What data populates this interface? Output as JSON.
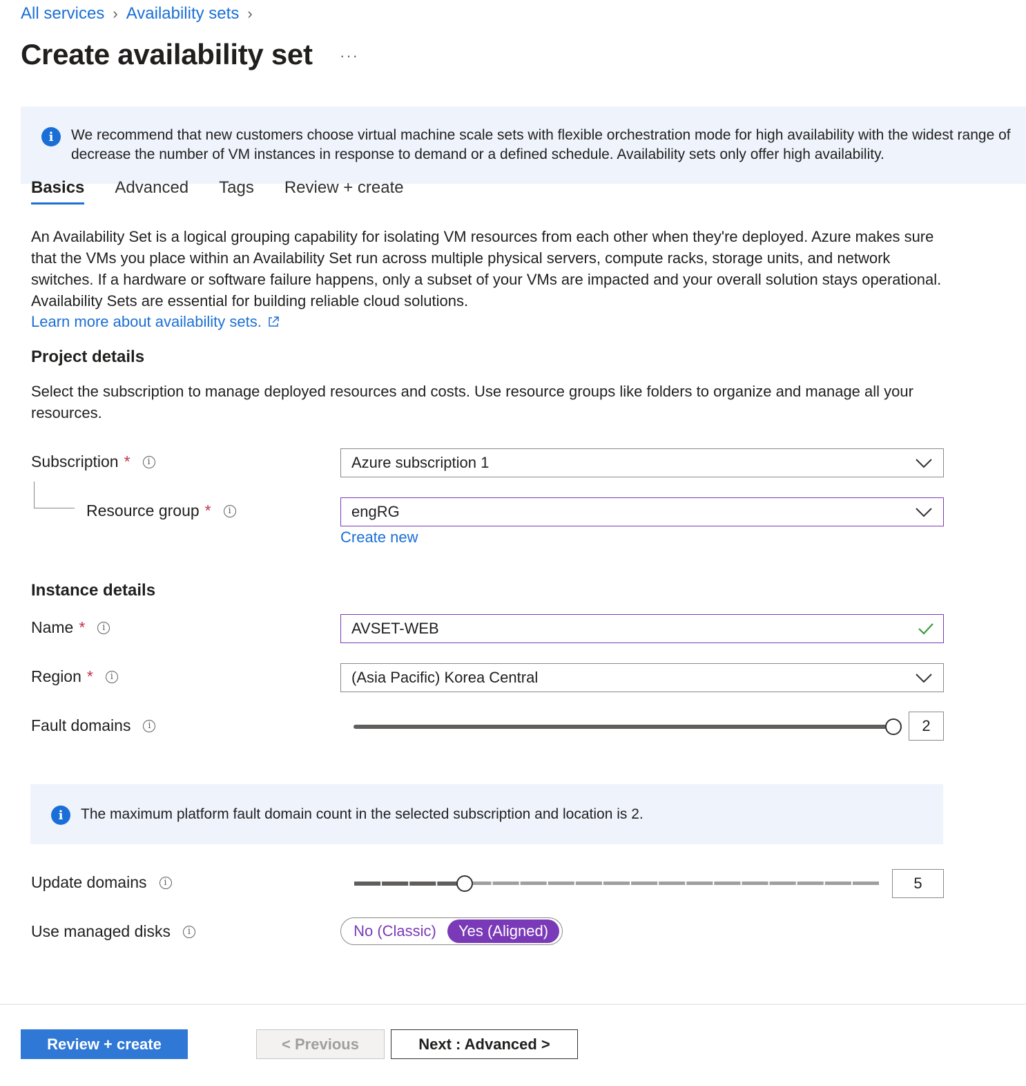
{
  "breadcrumb": {
    "items": [
      "All services",
      "Availability sets"
    ]
  },
  "page": {
    "title": "Create availability set",
    "more": "···"
  },
  "banner": {
    "line1": "We recommend that new customers choose virtual machine scale sets with flexible orchestration mode for high availability with the widest range of",
    "line2": "decrease the number of VM instances in response to demand or a defined schedule. Availability sets only offer high availability."
  },
  "tabs": [
    "Basics",
    "Advanced",
    "Tags",
    "Review + create"
  ],
  "description": "An Availability Set is a logical grouping capability for isolating VM resources from each other when they're deployed. Azure makes sure that the VMs you place within an Availability Set run across multiple physical servers, compute racks, storage units, and network switches. If a hardware or software failure happens, only a subset of your VMs are impacted and your overall solution stays operational. Availability Sets are essential for building reliable cloud solutions.",
  "learn_more": "Learn more about availability sets.",
  "project": {
    "heading": "Project details",
    "description": "Select the subscription to manage deployed resources and costs. Use resource groups like folders to organize and manage all your resources.",
    "subscription_label": "Subscription",
    "subscription_value": "Azure subscription 1",
    "resource_group_label": "Resource group",
    "resource_group_value": "engRG",
    "create_new": "Create new"
  },
  "instance": {
    "heading": "Instance details",
    "name_label": "Name",
    "name_value": "AVSET-WEB",
    "region_label": "Region",
    "region_value": "(Asia Pacific) Korea Central",
    "fault_label": "Fault domains",
    "fault_value": "2",
    "fault_fraction": 1.0,
    "fault_info": "The maximum platform fault domain count in the selected subscription and location is 2.",
    "update_label": "Update domains",
    "update_value": "5",
    "update_max": 20,
    "disks_label": "Use managed disks",
    "disks_options": [
      "No (Classic)",
      "Yes (Aligned)"
    ],
    "disks_selected": "Yes (Aligned)"
  },
  "required_mark": "*",
  "footer": {
    "review_create": "Review + create",
    "previous": "< Previous",
    "next": "Next : Advanced >"
  },
  "colors": {
    "accent": "#1a6fd6",
    "purple": "#7a3ab8",
    "required": "#c4314b",
    "banner_bg": "#eef3fc"
  },
  "icons": [
    "info-icon",
    "chevron-down-icon",
    "check-icon",
    "external-link-icon"
  ]
}
